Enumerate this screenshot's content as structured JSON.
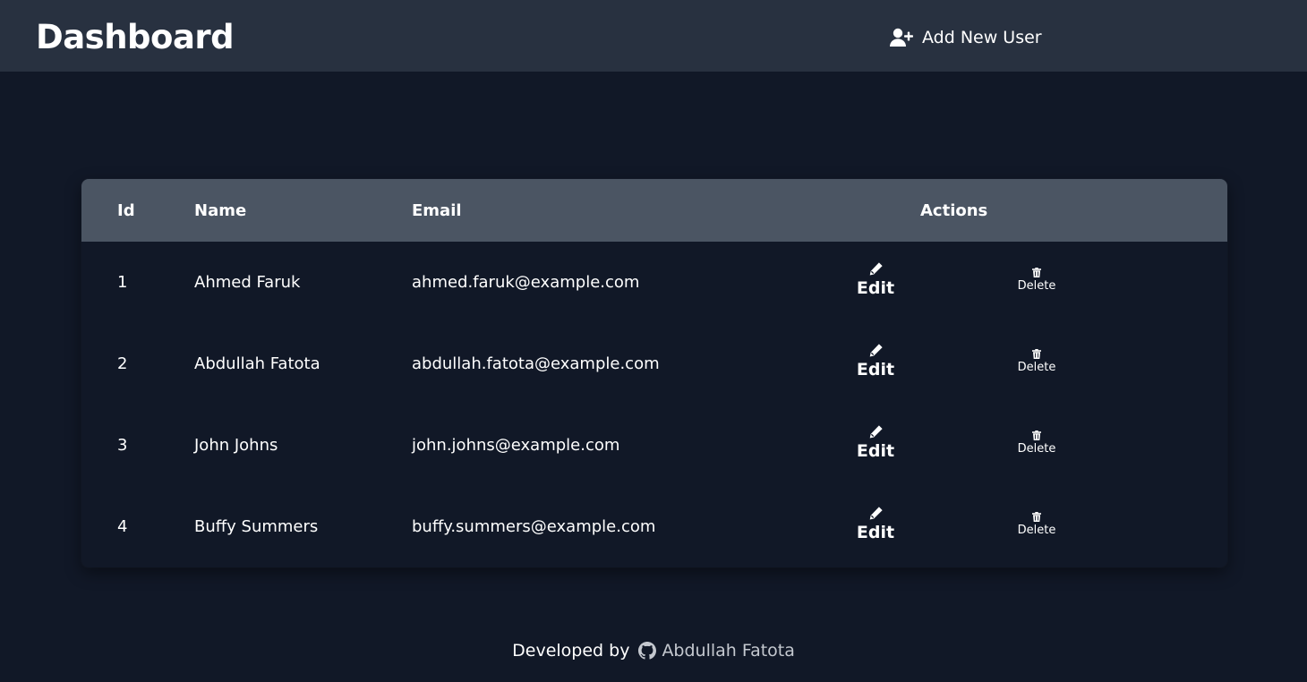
{
  "header": {
    "title": "Dashboard",
    "add_user_label": "Add New User"
  },
  "table": {
    "columns": [
      "Id",
      "Name",
      "Email",
      "Actions"
    ],
    "rows": [
      {
        "id": "1",
        "name": "Ahmed Faruk",
        "email": "ahmed.faruk@example.com"
      },
      {
        "id": "2",
        "name": "Abdullah Fatota",
        "email": "abdullah.fatota@example.com"
      },
      {
        "id": "3",
        "name": "John Johns",
        "email": "john.johns@example.com"
      },
      {
        "id": "4",
        "name": "Buffy Summers",
        "email": "buffy.summers@example.com"
      }
    ],
    "edit_label": "Edit",
    "delete_label": "Delete"
  },
  "footer": {
    "prefix": "Developed by",
    "author": "Abdullah Fatota"
  },
  "colors": {
    "background": "#111827",
    "topbar": "#283140",
    "table_header": "#4b5563",
    "text": "#ffffff",
    "muted_link": "#c4c8cf"
  },
  "icons": {
    "add_user": "user-plus-icon",
    "edit": "pencil-icon",
    "delete": "trash-icon",
    "footer": "github-icon"
  }
}
